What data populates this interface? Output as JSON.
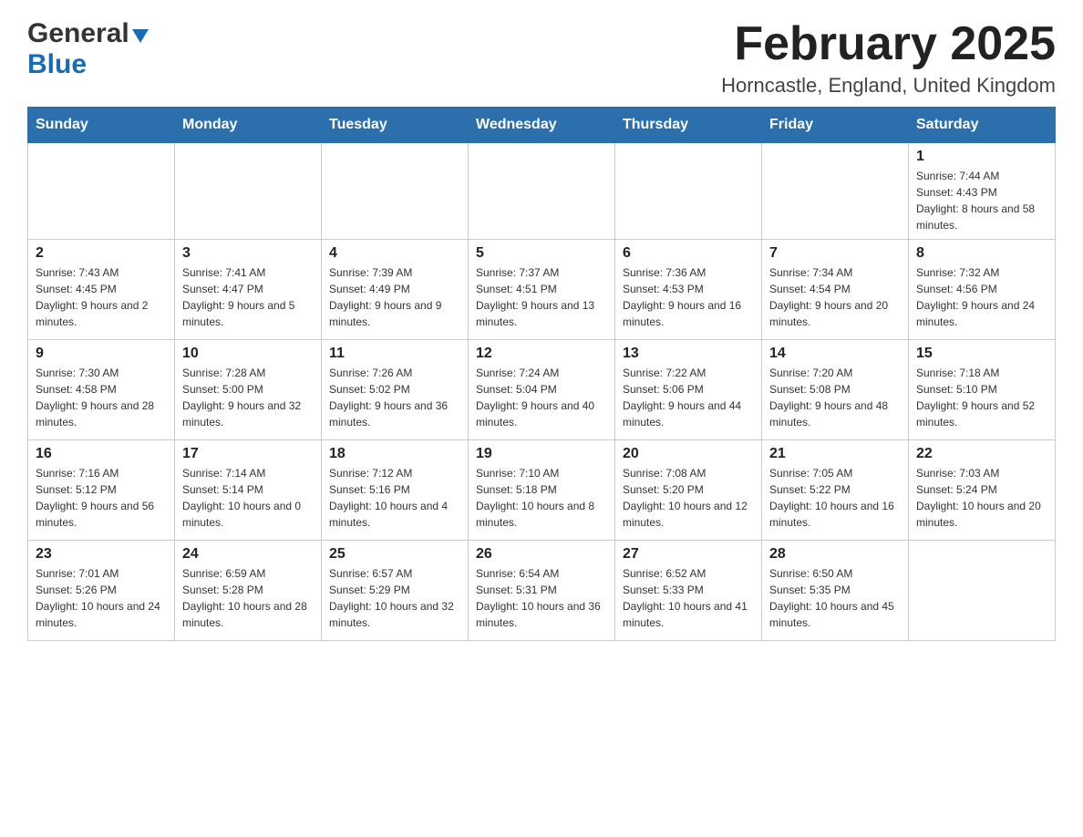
{
  "header": {
    "logo_general": "General",
    "logo_blue": "Blue",
    "month_title": "February 2025",
    "location": "Horncastle, England, United Kingdom"
  },
  "weekdays": [
    "Sunday",
    "Monday",
    "Tuesday",
    "Wednesday",
    "Thursday",
    "Friday",
    "Saturday"
  ],
  "weeks": [
    [
      {
        "day": "",
        "info": ""
      },
      {
        "day": "",
        "info": ""
      },
      {
        "day": "",
        "info": ""
      },
      {
        "day": "",
        "info": ""
      },
      {
        "day": "",
        "info": ""
      },
      {
        "day": "",
        "info": ""
      },
      {
        "day": "1",
        "info": "Sunrise: 7:44 AM\nSunset: 4:43 PM\nDaylight: 8 hours and 58 minutes."
      }
    ],
    [
      {
        "day": "2",
        "info": "Sunrise: 7:43 AM\nSunset: 4:45 PM\nDaylight: 9 hours and 2 minutes."
      },
      {
        "day": "3",
        "info": "Sunrise: 7:41 AM\nSunset: 4:47 PM\nDaylight: 9 hours and 5 minutes."
      },
      {
        "day": "4",
        "info": "Sunrise: 7:39 AM\nSunset: 4:49 PM\nDaylight: 9 hours and 9 minutes."
      },
      {
        "day": "5",
        "info": "Sunrise: 7:37 AM\nSunset: 4:51 PM\nDaylight: 9 hours and 13 minutes."
      },
      {
        "day": "6",
        "info": "Sunrise: 7:36 AM\nSunset: 4:53 PM\nDaylight: 9 hours and 16 minutes."
      },
      {
        "day": "7",
        "info": "Sunrise: 7:34 AM\nSunset: 4:54 PM\nDaylight: 9 hours and 20 minutes."
      },
      {
        "day": "8",
        "info": "Sunrise: 7:32 AM\nSunset: 4:56 PM\nDaylight: 9 hours and 24 minutes."
      }
    ],
    [
      {
        "day": "9",
        "info": "Sunrise: 7:30 AM\nSunset: 4:58 PM\nDaylight: 9 hours and 28 minutes."
      },
      {
        "day": "10",
        "info": "Sunrise: 7:28 AM\nSunset: 5:00 PM\nDaylight: 9 hours and 32 minutes."
      },
      {
        "day": "11",
        "info": "Sunrise: 7:26 AM\nSunset: 5:02 PM\nDaylight: 9 hours and 36 minutes."
      },
      {
        "day": "12",
        "info": "Sunrise: 7:24 AM\nSunset: 5:04 PM\nDaylight: 9 hours and 40 minutes."
      },
      {
        "day": "13",
        "info": "Sunrise: 7:22 AM\nSunset: 5:06 PM\nDaylight: 9 hours and 44 minutes."
      },
      {
        "day": "14",
        "info": "Sunrise: 7:20 AM\nSunset: 5:08 PM\nDaylight: 9 hours and 48 minutes."
      },
      {
        "day": "15",
        "info": "Sunrise: 7:18 AM\nSunset: 5:10 PM\nDaylight: 9 hours and 52 minutes."
      }
    ],
    [
      {
        "day": "16",
        "info": "Sunrise: 7:16 AM\nSunset: 5:12 PM\nDaylight: 9 hours and 56 minutes."
      },
      {
        "day": "17",
        "info": "Sunrise: 7:14 AM\nSunset: 5:14 PM\nDaylight: 10 hours and 0 minutes."
      },
      {
        "day": "18",
        "info": "Sunrise: 7:12 AM\nSunset: 5:16 PM\nDaylight: 10 hours and 4 minutes."
      },
      {
        "day": "19",
        "info": "Sunrise: 7:10 AM\nSunset: 5:18 PM\nDaylight: 10 hours and 8 minutes."
      },
      {
        "day": "20",
        "info": "Sunrise: 7:08 AM\nSunset: 5:20 PM\nDaylight: 10 hours and 12 minutes."
      },
      {
        "day": "21",
        "info": "Sunrise: 7:05 AM\nSunset: 5:22 PM\nDaylight: 10 hours and 16 minutes."
      },
      {
        "day": "22",
        "info": "Sunrise: 7:03 AM\nSunset: 5:24 PM\nDaylight: 10 hours and 20 minutes."
      }
    ],
    [
      {
        "day": "23",
        "info": "Sunrise: 7:01 AM\nSunset: 5:26 PM\nDaylight: 10 hours and 24 minutes."
      },
      {
        "day": "24",
        "info": "Sunrise: 6:59 AM\nSunset: 5:28 PM\nDaylight: 10 hours and 28 minutes."
      },
      {
        "day": "25",
        "info": "Sunrise: 6:57 AM\nSunset: 5:29 PM\nDaylight: 10 hours and 32 minutes."
      },
      {
        "day": "26",
        "info": "Sunrise: 6:54 AM\nSunset: 5:31 PM\nDaylight: 10 hours and 36 minutes."
      },
      {
        "day": "27",
        "info": "Sunrise: 6:52 AM\nSunset: 5:33 PM\nDaylight: 10 hours and 41 minutes."
      },
      {
        "day": "28",
        "info": "Sunrise: 6:50 AM\nSunset: 5:35 PM\nDaylight: 10 hours and 45 minutes."
      },
      {
        "day": "",
        "info": ""
      }
    ]
  ]
}
